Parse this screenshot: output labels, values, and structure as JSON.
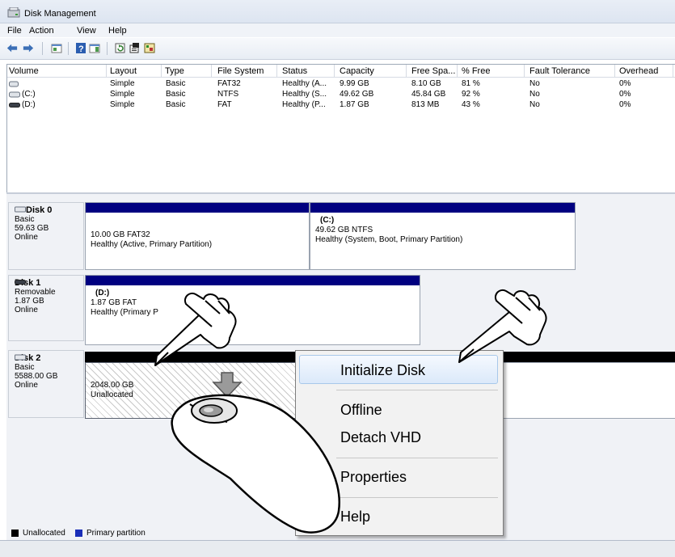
{
  "window": {
    "title": "Disk Management"
  },
  "menu": [
    "File",
    "Action",
    "View",
    "Help"
  ],
  "toolbar": {
    "icons": [
      "back-arrow-icon",
      "forward-arrow-icon",
      "console-tree-icon",
      "help-icon",
      "show-action-pane-icon",
      "refresh-icon",
      "properties-icon",
      "rescan-icon"
    ]
  },
  "volume_table": {
    "columns": [
      "Volume",
      "Layout",
      "Type",
      "File System",
      "Status",
      "Capacity",
      "Free Spa...",
      "% Free",
      "Fault Tolerance",
      "Overhead"
    ],
    "rows": [
      [
        "",
        "Simple",
        "Basic",
        "FAT32",
        "Healthy (A...",
        "9.99 GB",
        "8.10 GB",
        "81 %",
        "No",
        "0%"
      ],
      [
        "(C:)",
        "Simple",
        "Basic",
        "NTFS",
        "Healthy (S...",
        "49.62 GB",
        "45.84 GB",
        "92 %",
        "No",
        "0%"
      ],
      [
        "(D:)",
        "Simple",
        "Basic",
        "FAT",
        "Healthy (P...",
        "1.87 GB",
        "813 MB",
        "43 %",
        "No",
        "0%"
      ]
    ]
  },
  "disks": [
    {
      "name": "Disk 0",
      "type": "Basic",
      "size": "59.63 GB",
      "status": "Online",
      "partitions": [
        {
          "letter": "",
          "size": "10.00 GB FAT32",
          "status": "Healthy (Active, Primary Partition)"
        },
        {
          "letter": "(C:)",
          "size": "49.62 GB NTFS",
          "status": "Healthy (System, Boot, Primary Partition)"
        }
      ]
    },
    {
      "name": "Disk 1",
      "type": "Removable",
      "size": "1.87 GB",
      "status": "Online",
      "partitions": [
        {
          "letter": "(D:)",
          "size": "1.87 GB FAT",
          "status": "Healthy (Primary P"
        }
      ]
    },
    {
      "name": "Disk 2",
      "type": "Basic",
      "size": "5588.00 GB",
      "status": "Online",
      "partitions": [
        {
          "letter": "",
          "size": "2048.00 GB",
          "status": "Unallocated"
        }
      ]
    }
  ],
  "context_menu": {
    "items": [
      "Initialize Disk",
      "Offline",
      "Detach VHD",
      "Properties",
      "Help"
    ],
    "highlighted": "Initialize Disk"
  },
  "legend": {
    "items": [
      {
        "label": "Unallocated",
        "color": "#000000"
      },
      {
        "label": "Primary partition",
        "color": "#1a2eb8"
      }
    ]
  },
  "colors": {
    "partition_bar": "#000080",
    "selection": "#dbe9fa"
  }
}
